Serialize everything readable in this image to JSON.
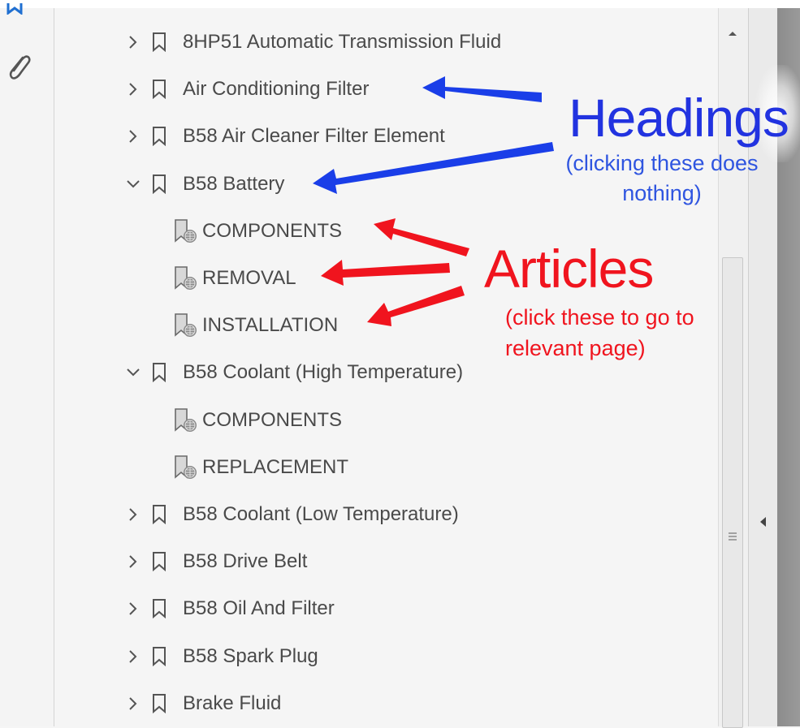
{
  "outline": {
    "rows": [
      {
        "type": "heading",
        "expanded": false,
        "label": "8HP51 Automatic Transmission Fluid"
      },
      {
        "type": "heading",
        "expanded": false,
        "label": "Air Conditioning Filter"
      },
      {
        "type": "heading",
        "expanded": false,
        "label": "B58 Air Cleaner Filter Element"
      },
      {
        "type": "heading",
        "expanded": true,
        "label": "B58 Battery"
      },
      {
        "type": "article",
        "label": "COMPONENTS"
      },
      {
        "type": "article",
        "label": "REMOVAL"
      },
      {
        "type": "article",
        "label": "INSTALLATION"
      },
      {
        "type": "heading",
        "expanded": true,
        "label": "B58 Coolant (High Temperature)"
      },
      {
        "type": "article",
        "label": "COMPONENTS"
      },
      {
        "type": "article",
        "label": "REPLACEMENT"
      },
      {
        "type": "heading",
        "expanded": false,
        "label": "B58 Coolant (Low Temperature)"
      },
      {
        "type": "heading",
        "expanded": false,
        "label": "B58 Drive Belt"
      },
      {
        "type": "heading",
        "expanded": false,
        "label": "B58 Oil And Filter"
      },
      {
        "type": "heading",
        "expanded": false,
        "label": "B58 Spark Plug"
      },
      {
        "type": "heading",
        "expanded": false,
        "label": "Brake Fluid"
      }
    ]
  },
  "annotations": {
    "headings_title": "Headings",
    "headings_note": "(clicking these does nothing)",
    "articles_title": "Articles",
    "articles_note": "(click these to go to relevant page)"
  },
  "icons": {
    "rail": [
      "bookmark-icon",
      "paperclip-icon"
    ],
    "scroll": [
      "scroll-up-icon",
      "scroll-grip-icon",
      "collapse-panel-icon"
    ]
  },
  "colors": {
    "headings_annotation": "#2233e0",
    "articles_annotation": "#f0141e",
    "rail_icon_blue": "#1f6fd1"
  }
}
